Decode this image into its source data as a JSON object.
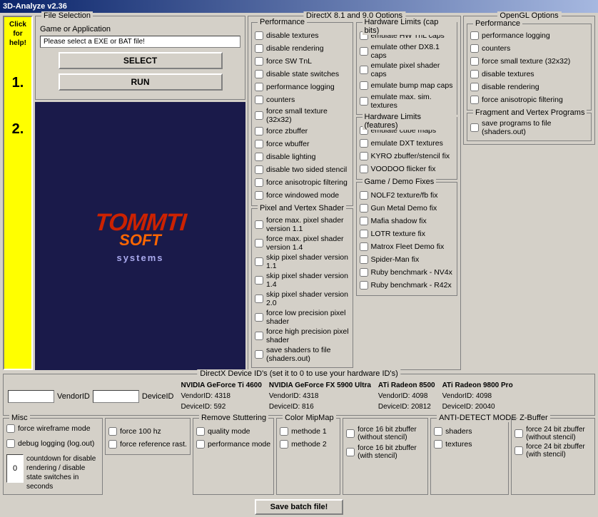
{
  "app": {
    "title": "3D-Analyze v2.36",
    "click_help": "Click for help!",
    "number1": "1.",
    "number2": "2."
  },
  "file_selection": {
    "title": "File Selection",
    "label": "Game or Application",
    "placeholder": "Please select a EXE or BAT file!",
    "select_label": "SELECT",
    "run_label": "RUN"
  },
  "directx": {
    "header": "DirectX 8.1 and 9.0 Options",
    "performance": {
      "title": "Performance",
      "items": [
        "disable textures",
        "disable rendering",
        "force SW TnL",
        "disable state switches",
        "performance logging",
        "counters",
        "force small texture (32x32)",
        "force zbuffer",
        "force wbuffer",
        "disable lighting",
        "disable two sided stencil",
        "force anisotropic filtering",
        "force windowed mode"
      ]
    },
    "pixel_vertex": {
      "title": "Pixel and Vertex Shader",
      "items": [
        "force max. pixel shader version 1.1",
        "force max. pixel shader version 1.4",
        "skip pixel shader version 1.1",
        "skip pixel shader version 1.4",
        "skip pixel shader version 2.0",
        "force low precision pixel shader",
        "force high precision pixel shader",
        "save shaders to file (shaders.out)"
      ]
    },
    "hardware_caps": {
      "title": "Hardware Limits (cap bits)",
      "items": [
        "emulate HW TnL caps",
        "emulate other DX8.1 caps",
        "emulate pixel shader caps",
        "emulate bump map caps",
        "emulate max. sim. textures"
      ]
    },
    "hardware_features": {
      "title": "Hardware Limits (features)",
      "items": [
        "emulate cube maps",
        "emulate DXT textures",
        "KYRO zbuffer/stencil fix",
        "VOODOO flicker fix"
      ]
    },
    "game_fixes": {
      "title": "Game / Demo Fixes",
      "items": [
        "NOLF2 texture/fb fix",
        "Gun Metal Demo fix",
        "Mafia shadow fix",
        "LOTR texture fix",
        "Matrox Fleet Demo fix",
        "Spider-Man fix",
        "Ruby benchmark - NV4x",
        "Ruby benchmark - R42x"
      ]
    }
  },
  "opengl": {
    "header": "OpenGL Options",
    "performance": {
      "title": "Performance",
      "items": [
        "performance logging",
        "counters",
        "force small texture (32x32)",
        "disable textures",
        "disable rendering",
        "force anisotropic filtering"
      ]
    },
    "fragment": {
      "title": "Fragment and Vertex Programs",
      "items": [
        "save programs to file (shaders.out)"
      ]
    }
  },
  "device_ids": {
    "title": "DirectX Device ID's (set it to 0 to use your hardware ID's)",
    "vendor_label": "VendorID",
    "device_label": "DeviceID",
    "vendor_value": "",
    "device_value": "",
    "cards": [
      {
        "name": "NVIDIA GeForce Ti 4600",
        "vendor": "VendorID: 4318",
        "device": "DeviceID: 592"
      },
      {
        "name": "NVIDIA GeForce FX 5900 Ultra",
        "vendor": "VendorID: 4318",
        "device": "DeviceID: 816"
      },
      {
        "name": "ATi Radeon 8500",
        "vendor": "VendorID: 4098",
        "device": "DeviceID: 20812"
      },
      {
        "name": "ATi Radeon 9800 Pro",
        "vendor": "VendorID: 4098",
        "device": "DeviceID: 20040"
      }
    ]
  },
  "misc": {
    "title": "Misc",
    "force_wireframe": "force wireframe mode",
    "debug_logging": "debug logging (log.out)",
    "force_100hz": "force 100 hz",
    "force_ref": "force reference rast.",
    "countdown_label": "countdown for disable rendering / disable state switches in seconds",
    "countdown_value": "0",
    "remove_stutter": {
      "title": "Remove Stuttering",
      "quality": "quality mode",
      "performance": "performance mode"
    },
    "color_mipmap": {
      "title": "Color MipMap",
      "methode1": "methode 1",
      "methode2": "methode 2"
    }
  },
  "anti_detect": {
    "title": "ANTI-DETECT MODE",
    "shaders": "shaders",
    "textures": "textures"
  },
  "zbuffer": {
    "title": "Z-Buffer",
    "items": [
      "force 24 bit zbuffer (without stencil)",
      "force 16 bit zbuffer (without stencil)",
      "force 16 bit zbuffer (with stencil)",
      "force 24 bit zbuffer (with stencil)"
    ]
  },
  "save_button": "Save batch file!"
}
